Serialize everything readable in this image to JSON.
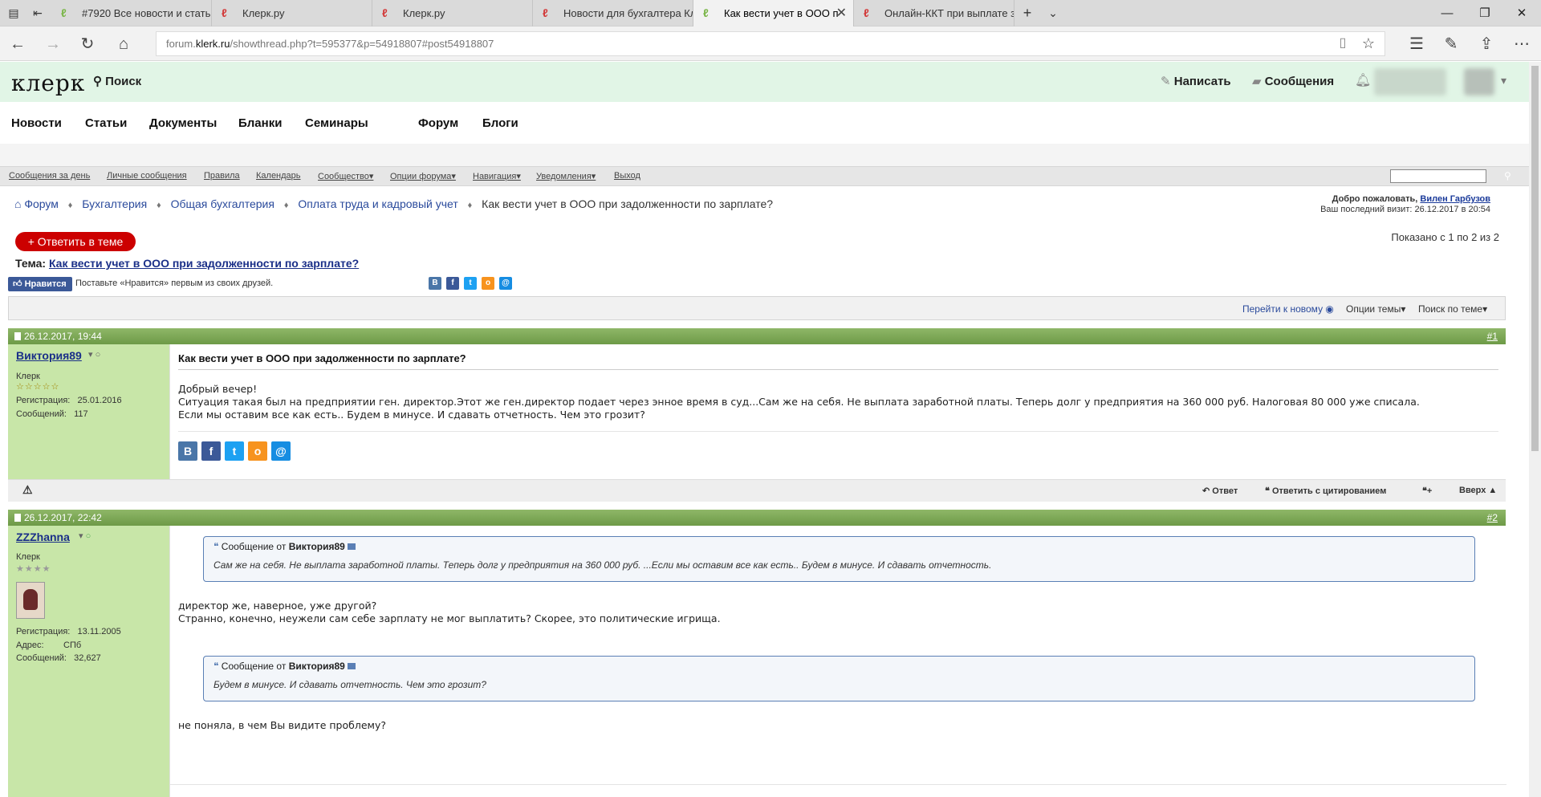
{
  "browser": {
    "tabs": [
      {
        "label": "#7920 Все новости и стать",
        "fav": "ℓ",
        "favcolor": "#7ab648"
      },
      {
        "label": "Клерк.ру",
        "fav": "ℓ",
        "favcolor": "#d23a3a"
      },
      {
        "label": "Клерк.ру",
        "fav": "ℓ",
        "favcolor": "#d23a3a"
      },
      {
        "label": "Новости для бухгалтера Кл",
        "fav": "ℓ",
        "favcolor": "#d23a3a"
      },
      {
        "label": "Как вести учет в ООО п",
        "fav": "ℓ",
        "favcolor": "#7ab648"
      },
      {
        "label": "Онлайн-ККТ при выплате з",
        "fav": "ℓ",
        "favcolor": "#d23a3a"
      }
    ],
    "url_domain_pre": "forum.",
    "url_domain": "klerk.ru",
    "url_path": "/showthread.php?t=595377&p=54918807#post54918807"
  },
  "site": {
    "logo": "клерк",
    "search": "Поиск",
    "write": "Написать",
    "messages": "Сообщения"
  },
  "menu": [
    "Новости",
    "Статьи",
    "Документы",
    "Бланки",
    "Семинары",
    "Форум",
    "Блоги"
  ],
  "navstrip": [
    "Сообщения за день",
    "Личные сообщения",
    "Правила",
    "Календарь",
    "Сообщество▾",
    "Опции форума▾",
    "Навигация▾",
    "Уведомления▾",
    "Выход"
  ],
  "breadcrumb": [
    "Форум",
    "Бухгалтерия",
    "Общая бухгалтерия",
    "Оплата труда и кадровый учет",
    "Как вести учет в ООО при задолженности по зарплате?"
  ],
  "welcome": {
    "line1": "Добро пожаловать, ",
    "user": "Вилен Гарбузов",
    "line2": "Ваш последний визит: 26.12.2017 в 20:54"
  },
  "reply_button": "+ Ответить в теме",
  "shown": "Показано с 1 по 2 из 2",
  "topic": {
    "label": "Тема: ",
    "title": "Как вести учет в ООО при задолженности по зарплате?"
  },
  "like": {
    "button": "Нравится",
    "text": "Поставьте «Нравится» первым из своих друзей."
  },
  "thread_tools": {
    "goto_new": "Перейти к новому",
    "options": "Опции темы",
    "search": "Поиск по теме"
  },
  "posts": [
    {
      "date": "26.12.2017, 19:44",
      "num": "#1",
      "user": "Виктория89",
      "rank": "Клерк",
      "stars": "☆☆☆☆☆",
      "reg_label": "Регистрация:",
      "reg": "25.01.2016",
      "msgs_label": "Сообщений:",
      "msgs": "117",
      "title": "Как вести учет в ООО при задолженности по зарплате?",
      "lines": [
        "Добрый вечер!",
        "Ситуация такая был на предприятии ген. директор.Этот же ген.директор подает через энное время в суд...Сам же на себя. Не выплата заработной платы. Теперь долг у предприятия на 360 000 руб. Налоговая 80 000 уже списала.",
        "Если мы оставим все как есть.. Будем в минусе. И сдавать отчетность. Чем это грозит?"
      ]
    },
    {
      "date": "26.12.2017, 22:42",
      "num": "#2",
      "user": "ZZZhanna",
      "rank": "Клерк",
      "stars": "★★★★",
      "reg_label": "Регистрация:",
      "reg": "13.11.2005",
      "addr_label": "Адрес:",
      "addr": "СПб",
      "msgs_label": "Сообщений:",
      "msgs": "32,627",
      "quote1_prefix": "Сообщение от ",
      "quote1_author": "Виктория89",
      "quote1_text": "Сам же на себя. Не выплата заработной платы. Теперь долг у предприятия на 360 000 руб. ...Если мы оставим все как есть.. Будем в минусе. И сдавать отчетность.",
      "text1": "директор же, наверное, уже другой?",
      "text2": "Странно, конечно, неужели сам себе зарплату не мог выплатить? Скорее, это политические игрища.",
      "quote2_prefix": "Сообщение от ",
      "quote2_author": "Виктория89",
      "quote2_text": "Будем в минусе. И сдавать отчетность. Чем это грозит?",
      "text3": "не поняла, в чем Вы видите проблему?"
    }
  ],
  "post_footer": {
    "reply": "Ответ",
    "reply_quote": "Ответить с цитированием",
    "top": "Вверх ▲"
  }
}
